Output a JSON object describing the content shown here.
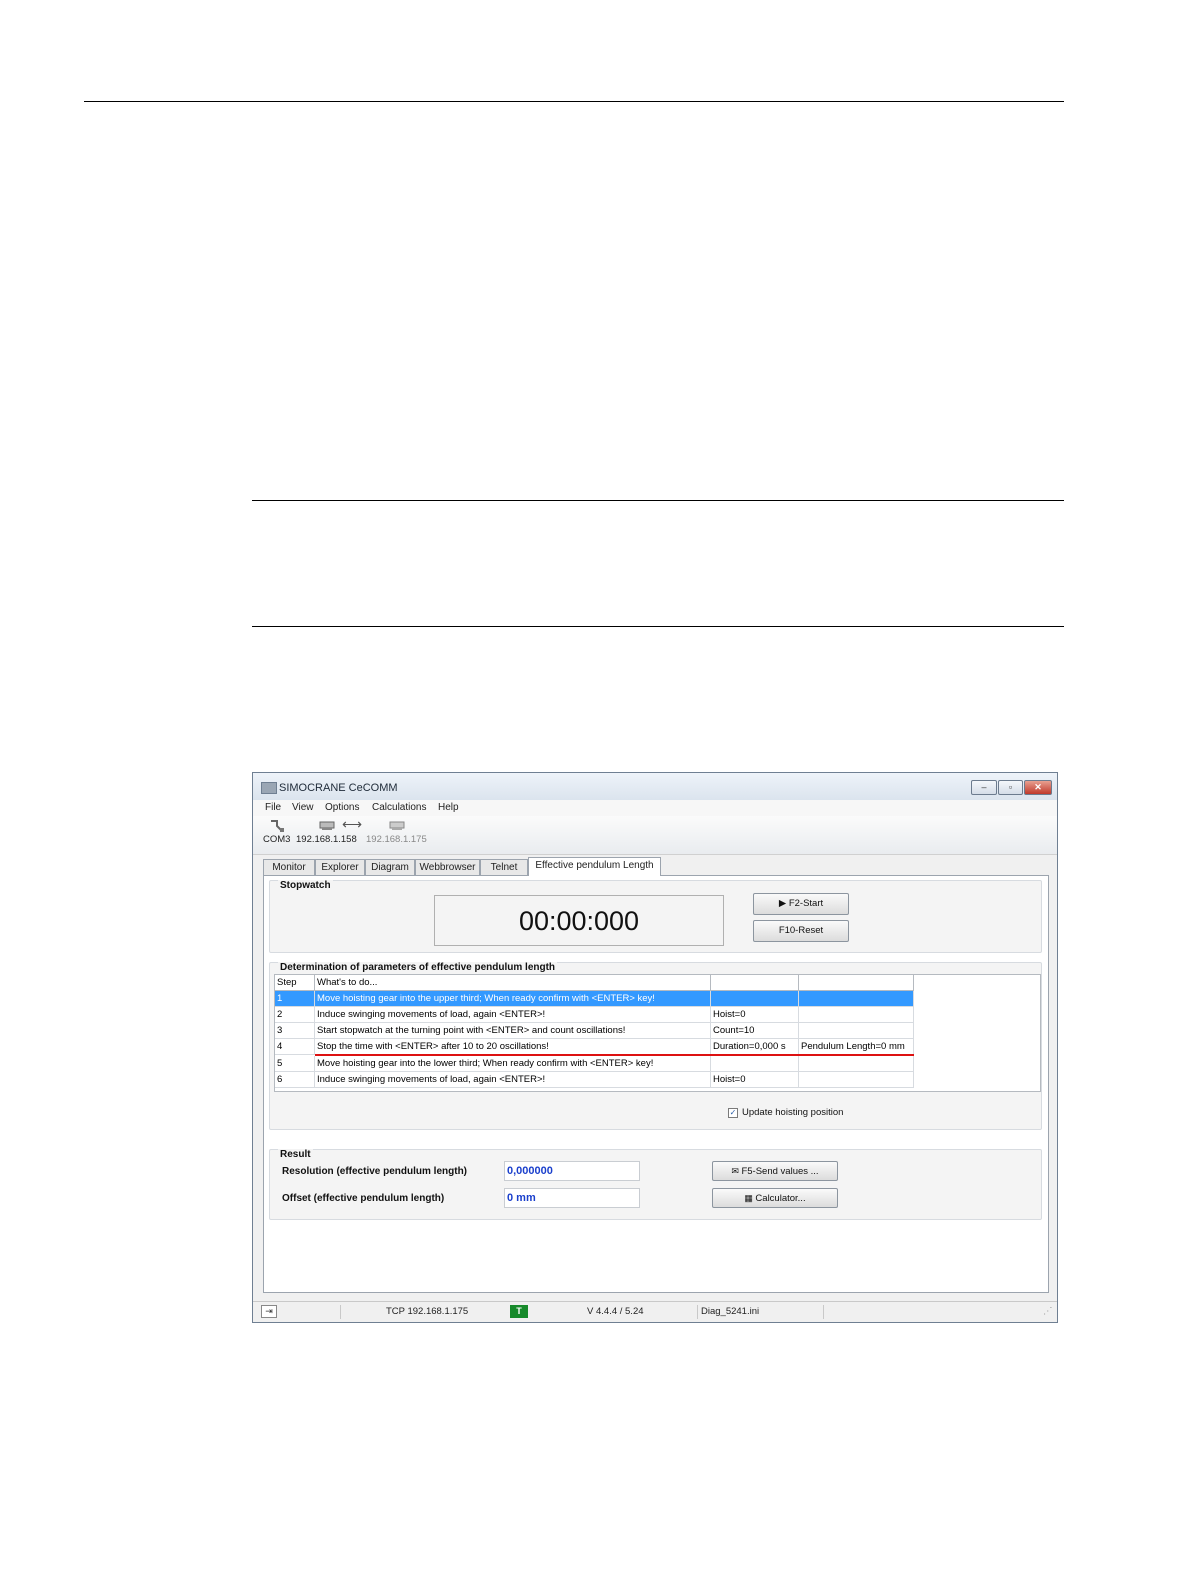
{
  "window": {
    "title": "SIMOCRANE CeCOMM",
    "controls": {
      "minimize": "–",
      "maximize": "▫",
      "close": "✕"
    }
  },
  "menu": {
    "items": [
      "File",
      "View",
      "Options",
      "Calculations",
      "Help"
    ]
  },
  "toolbar": {
    "com_label": "COM3",
    "ip_local": "192.168.1.158",
    "ip_remote": "192.168.1.175",
    "connection_glyph": "⟷"
  },
  "tabs": [
    "Monitor",
    "Explorer",
    "Diagram",
    "Webbrowser",
    "Telnet",
    "Effective pendulum Length"
  ],
  "stopwatch": {
    "label": "Stopwatch",
    "time": "00:00:000",
    "start_label": "F2-Start",
    "reset_label": "F10-Reset"
  },
  "determination": {
    "label": "Determination of parameters of effective pendulum length",
    "columns": [
      "Step",
      "What's to do...",
      "",
      ""
    ],
    "rows": [
      {
        "step": "1",
        "todo": "Move hoisting gear into the upper third; When ready confirm with <ENTER> key!",
        "c3": "",
        "c4": ""
      },
      {
        "step": "2",
        "todo": "Induce swinging movements of load, again <ENTER>!",
        "c3": "Hoist=0",
        "c4": ""
      },
      {
        "step": "3",
        "todo": "Start stopwatch at the turning point with <ENTER> and count oscillations!",
        "c3": "Count=10",
        "c4": ""
      },
      {
        "step": "4",
        "todo": "Stop the time with <ENTER> after 10 to 20 oscillations!",
        "c3": "Duration=0,000 s",
        "c4": "Pendulum Length=0 mm"
      },
      {
        "step": "5",
        "todo": "Move hoisting gear into the lower third; When ready confirm with <ENTER> key!",
        "c3": "",
        "c4": ""
      },
      {
        "step": "6",
        "todo": "Induce swinging movements of load, again <ENTER>!",
        "c3": "Hoist=0",
        "c4": ""
      }
    ],
    "selected_row": 1,
    "update_checkbox_label": "Update hoisting position",
    "update_checked": true
  },
  "result": {
    "label": "Result",
    "resolution_label": "Resolution (effective pendulum length)",
    "resolution_value": "0,000000",
    "offset_label": "Offset (effective pendulum length)",
    "offset_value": "0 mm",
    "send_label": "F5-Send values ...",
    "calc_label": "Calculator..."
  },
  "statusbar": {
    "connection": "TCP 192.168.1.175",
    "badge": "T",
    "version": "V 4.4.4 / 5.24",
    "file": "Diag_5241.ini",
    "badge_color": "#178a2b"
  },
  "accent": {
    "selection": "#3399ff",
    "value_text": "#1a3fcc",
    "highlight_line": "#dd1111"
  }
}
